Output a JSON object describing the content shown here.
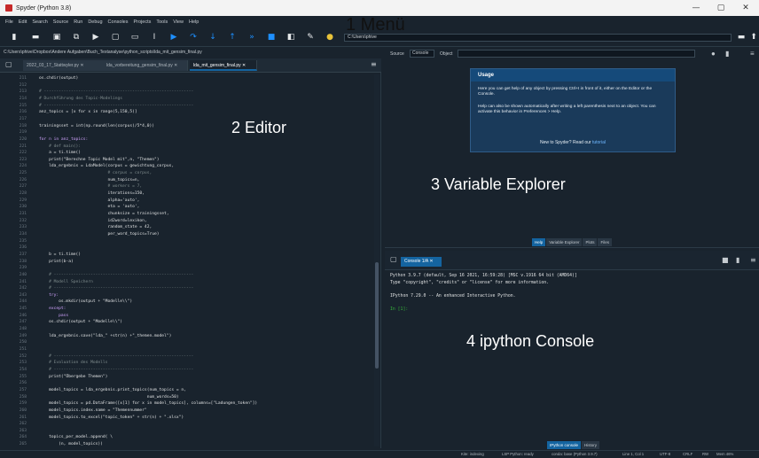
{
  "window": {
    "title": "Spyder (Python 3.8)",
    "controls": [
      "—",
      "▢",
      "✕"
    ]
  },
  "menubar": [
    "File",
    "Edit",
    "Search",
    "Source",
    "Run",
    "Debug",
    "Consoles",
    "Projects",
    "Tools",
    "View",
    "Help"
  ],
  "toolbar": {
    "icons": [
      "new-file-icon",
      "open-folder-icon",
      "save-icon",
      "save-all-icon",
      "run-icon",
      "run-cell-icon",
      "run-cell-advance-icon",
      "run-selection-icon",
      "debug-icon",
      "step-icon",
      "step-into-icon",
      "step-out-icon",
      "continue-icon",
      "stop-icon",
      "maximize-pane-icon",
      "preferences-icon",
      "python-path-icon"
    ],
    "path": "C:\\Users\\phive",
    "browse_icon": "folder-icon",
    "up_icon": "arrow-up-icon"
  },
  "editor": {
    "path": "C:\\Users\\phive\\Dropbox\\Andere Aufgaben\\Buch_Textanalyse\\python_scripts\\lda_mit_gensim_final.py",
    "tabs": [
      {
        "label": "2022_03_17_Stattwyler.py",
        "active": false
      },
      {
        "label": "lda_vorbereitung_gensim_final.py",
        "active": false
      },
      {
        "label": "lda_mit_gensim_final.py",
        "active": true
      }
    ],
    "line_numbers": [
      "211",
      "212",
      "213",
      "214",
      "215",
      "216",
      "217",
      "218",
      "219",
      "220",
      "221",
      "222",
      "223",
      "224",
      "225",
      "226",
      "227",
      "228",
      "229",
      "230",
      "231",
      "232",
      "233",
      "234",
      "235",
      "236",
      "237",
      "238",
      "239",
      "240",
      "241",
      "242",
      "243",
      "244",
      "245",
      "246",
      "247",
      "248",
      "249",
      "250",
      "251",
      "252",
      "253",
      "254",
      "255",
      "256",
      "257",
      "258",
      "259",
      "260",
      "261",
      "262",
      "263",
      "264",
      "265"
    ],
    "lines": [
      {
        "t": "os.chdir(output)",
        "c": ""
      },
      {
        "t": "",
        "c": ""
      },
      {
        "t": "# -------------------------------------------------------------",
        "c": "cm"
      },
      {
        "t": "# Durchführung des Topic-Modelings",
        "c": "cm"
      },
      {
        "t": "# -------------------------------------------------------------",
        "c": "cm"
      },
      {
        "t": "anz_topics = [x for x in range(5,150,5)]",
        "c": ""
      },
      {
        "t": "",
        "c": ""
      },
      {
        "t": "trainingsset = int(np.round(len(corpus)/5*4,0))",
        "c": ""
      },
      {
        "t": "",
        "c": ""
      },
      {
        "t": "for n in anz_topics:",
        "c": "kw"
      },
      {
        "t": "    # def main():",
        "c": "cm"
      },
      {
        "t": "    a = ti.time()",
        "c": ""
      },
      {
        "t": "    print(\"Berechne Topic Model mit\",n, \"Themen\")",
        "c": ""
      },
      {
        "t": "    lda_ergebnis = LdaModel(corpus = gewichtung_corpus,",
        "c": ""
      },
      {
        "t": "                            # corpus = corpus,",
        "c": "cm"
      },
      {
        "t": "                            num_topics=n,",
        "c": ""
      },
      {
        "t": "                            # workers = 7,",
        "c": "cm"
      },
      {
        "t": "                            iterations=150,",
        "c": ""
      },
      {
        "t": "                            alpha='auto',",
        "c": ""
      },
      {
        "t": "                            eta = 'auto',",
        "c": ""
      },
      {
        "t": "                            chunksize = trainingsset,",
        "c": ""
      },
      {
        "t": "                            id2word=lexikon,",
        "c": ""
      },
      {
        "t": "                            random_state = 42,",
        "c": ""
      },
      {
        "t": "                            per_word_topics=True)",
        "c": ""
      },
      {
        "t": "",
        "c": ""
      },
      {
        "t": "",
        "c": ""
      },
      {
        "t": "    b = ti.time()",
        "c": ""
      },
      {
        "t": "    print(b-a)",
        "c": ""
      },
      {
        "t": "",
        "c": ""
      },
      {
        "t": "    # ---------------------------------------------------------",
        "c": "cm"
      },
      {
        "t": "    # Modell Speichern",
        "c": "cm"
      },
      {
        "t": "    # ---------------------------------------------------------",
        "c": "cm"
      },
      {
        "t": "    try:",
        "c": "kw"
      },
      {
        "t": "        os.mkdir(output + \"Modelle\\\\\")",
        "c": ""
      },
      {
        "t": "    except:",
        "c": "kw"
      },
      {
        "t": "        pass",
        "c": "kw"
      },
      {
        "t": "    os.chdir(output + \"Modelle\\\\\")",
        "c": ""
      },
      {
        "t": "",
        "c": ""
      },
      {
        "t": "    lda_ergebnis.save(\"lda_\" +str(n) +\"_themen.model\")",
        "c": ""
      },
      {
        "t": "",
        "c": ""
      },
      {
        "t": "",
        "c": ""
      },
      {
        "t": "    # ---------------------------------------------------------",
        "c": "cm"
      },
      {
        "t": "    # Evaluation des Modells",
        "c": "cm"
      },
      {
        "t": "    # ---------------------------------------------------------",
        "c": "cm"
      },
      {
        "t": "    print(\"Übergebe Themen\")",
        "c": ""
      },
      {
        "t": "",
        "c": ""
      },
      {
        "t": "    model_topics = lda_ergebnis.print_topics(num_topics = n,",
        "c": ""
      },
      {
        "t": "                                            num_words=50)",
        "c": ""
      },
      {
        "t": "    model_topics = pd.DataFrame([x[1] for x in model_topics], columns=[\"Ladungen_token\"])",
        "c": ""
      },
      {
        "t": "    model_topics.index.name = \"Themennummer\"",
        "c": ""
      },
      {
        "t": "    model_topics.to_excel(\"topic_token\" + str(n) + \".xlsx\")",
        "c": ""
      },
      {
        "t": "",
        "c": ""
      },
      {
        "t": "",
        "c": ""
      },
      {
        "t": "    topics_per_model.append( \\",
        "c": ""
      },
      {
        "t": "        (n, model_topics))",
        "c": ""
      }
    ]
  },
  "help": {
    "source_label": "Source",
    "source_value": "Console",
    "object_label": "Object",
    "usage_title": "Usage",
    "usage_p1": "Here you can get help of any object by pressing Ctrl+I in front of it, either on the Editor or the Console.",
    "usage_p2": "Help can also be shown automatically after writing a left parenthesis next to an object. You can activate this behavior in Preferences > Help.",
    "usage_foot": "New to Spyder? Read our",
    "usage_link": "tutorial",
    "tabs": [
      {
        "label": "Help",
        "active": true
      },
      {
        "label": "Variable Explorer",
        "active": false
      },
      {
        "label": "Plots",
        "active": false
      },
      {
        "label": "Files",
        "active": false
      }
    ]
  },
  "console": {
    "tab_label": "Console 1/A",
    "lines": [
      {
        "t": "Python 3.9.7 (default, Sep 16 2021, 16:59:28) [MSC v.1916 64 bit (AMD64)]",
        "c": ""
      },
      {
        "t": "Type \"copyright\", \"credits\" or \"license\" for more information.",
        "c": ""
      },
      {
        "t": "",
        "c": ""
      },
      {
        "t": "IPython 7.29.0 -- An enhanced Interactive Python.",
        "c": ""
      },
      {
        "t": "",
        "c": ""
      },
      {
        "t": "In [1]:",
        "c": "prompt"
      }
    ],
    "tabs": [
      {
        "label": "IPython console",
        "active": true
      },
      {
        "label": "History",
        "active": false
      }
    ]
  },
  "statusbar": {
    "items": [
      "Kite: indexing",
      "LSP Python: ready",
      "conda: base (Python 3.9.7)",
      "Line 1, Col 1",
      "UTF-8",
      "CRLF",
      "RW",
      "Mem 46%"
    ]
  },
  "overlay_labels": {
    "menu": "1 Menü",
    "editor": "2 Editor",
    "variable_explorer": "3 Variable Explorer",
    "ipython_console": "4 ipython Console"
  }
}
